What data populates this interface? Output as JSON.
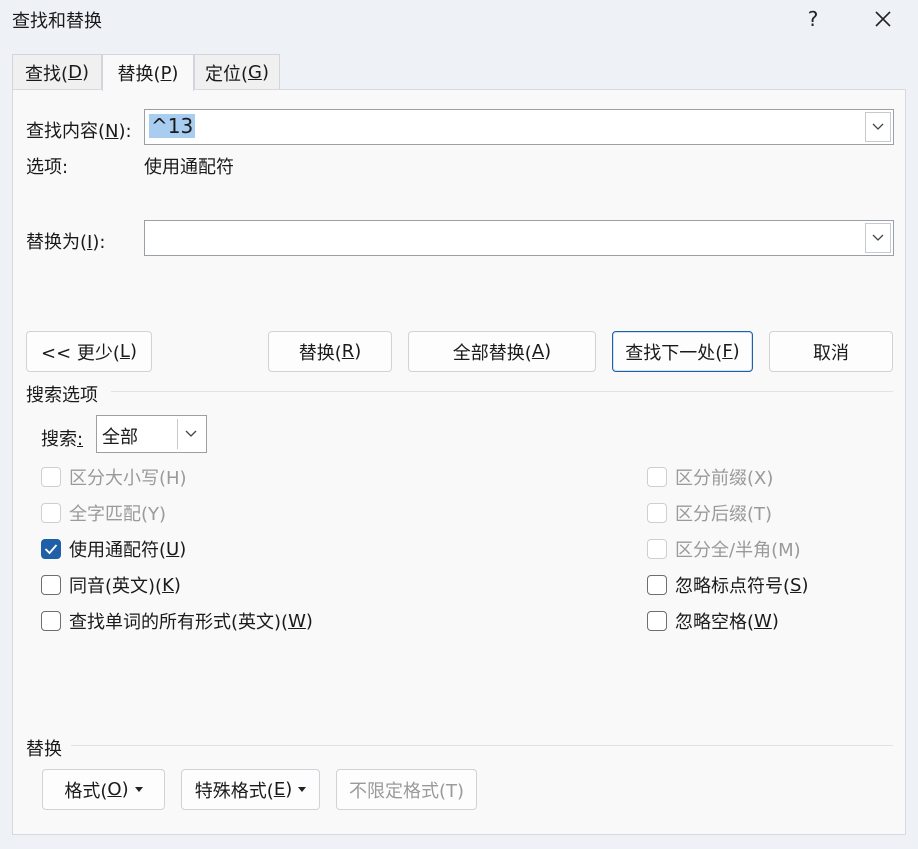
{
  "window": {
    "title": "查找和替换",
    "help_label": "?"
  },
  "tabs": [
    {
      "label": "查找(",
      "key": "D",
      "suffix": ")"
    },
    {
      "label": "替换(",
      "key": "P",
      "suffix": ")"
    },
    {
      "label": "定位(",
      "key": "G",
      "suffix": ")"
    }
  ],
  "find": {
    "label": "查找内容(",
    "key": "N",
    "suffix": "):",
    "value": "^13"
  },
  "options": {
    "label": "选项:",
    "value": "使用通配符"
  },
  "replace": {
    "label": "替换为(",
    "key": "I",
    "suffix": "):",
    "value": ""
  },
  "buttons": {
    "less": {
      "label": "<< 更少(",
      "key": "L",
      "suffix": ")"
    },
    "replace": {
      "label": "替换(",
      "key": "R",
      "suffix": ")"
    },
    "replace_all": {
      "label": "全部替换(",
      "key": "A",
      "suffix": ")"
    },
    "find_next": {
      "label": "查找下一处(",
      "key": "F",
      "suffix": ")"
    },
    "cancel": {
      "label": "取消"
    }
  },
  "search_options": {
    "heading": "搜索选项",
    "search_label": "搜索",
    "search_colon": ":",
    "search_value": "全部"
  },
  "checkboxes_left": [
    {
      "label": "区分大小写(H)",
      "checked": false,
      "disabled": true
    },
    {
      "label": "全字匹配(Y)",
      "checked": false,
      "disabled": true
    },
    {
      "label": "使用通配符(",
      "key": "U",
      "suffix": ")",
      "checked": true,
      "disabled": false
    },
    {
      "label": "同音(英文)(",
      "key": "K",
      "suffix": ")",
      "checked": false,
      "disabled": false
    },
    {
      "label": "查找单词的所有形式(英文)(",
      "key": "W",
      "suffix": ")",
      "checked": false,
      "disabled": false
    }
  ],
  "checkboxes_right": [
    {
      "label": "区分前缀(X)",
      "checked": false,
      "disabled": true
    },
    {
      "label": "区分后缀(T)",
      "checked": false,
      "disabled": true
    },
    {
      "label": "区分全/半角(M)",
      "checked": false,
      "disabled": true
    },
    {
      "label": "忽略标点符号(",
      "key": "S",
      "suffix": ")",
      "checked": false,
      "disabled": false
    },
    {
      "label": "忽略空格(",
      "key": "W",
      "suffix": ")",
      "checked": false,
      "disabled": false
    }
  ],
  "replace_section": {
    "heading": "替换",
    "format": {
      "label": "格式(",
      "key": "O",
      "suffix": ")"
    },
    "special": {
      "label": "特殊格式(",
      "key": "E",
      "suffix": ")"
    },
    "no_format": {
      "label": "不限定格式(T)"
    }
  },
  "colors": {
    "accent": "#1f5fa8",
    "selection": "#a8cdf0",
    "disabled_text": "#9a9a9a"
  }
}
